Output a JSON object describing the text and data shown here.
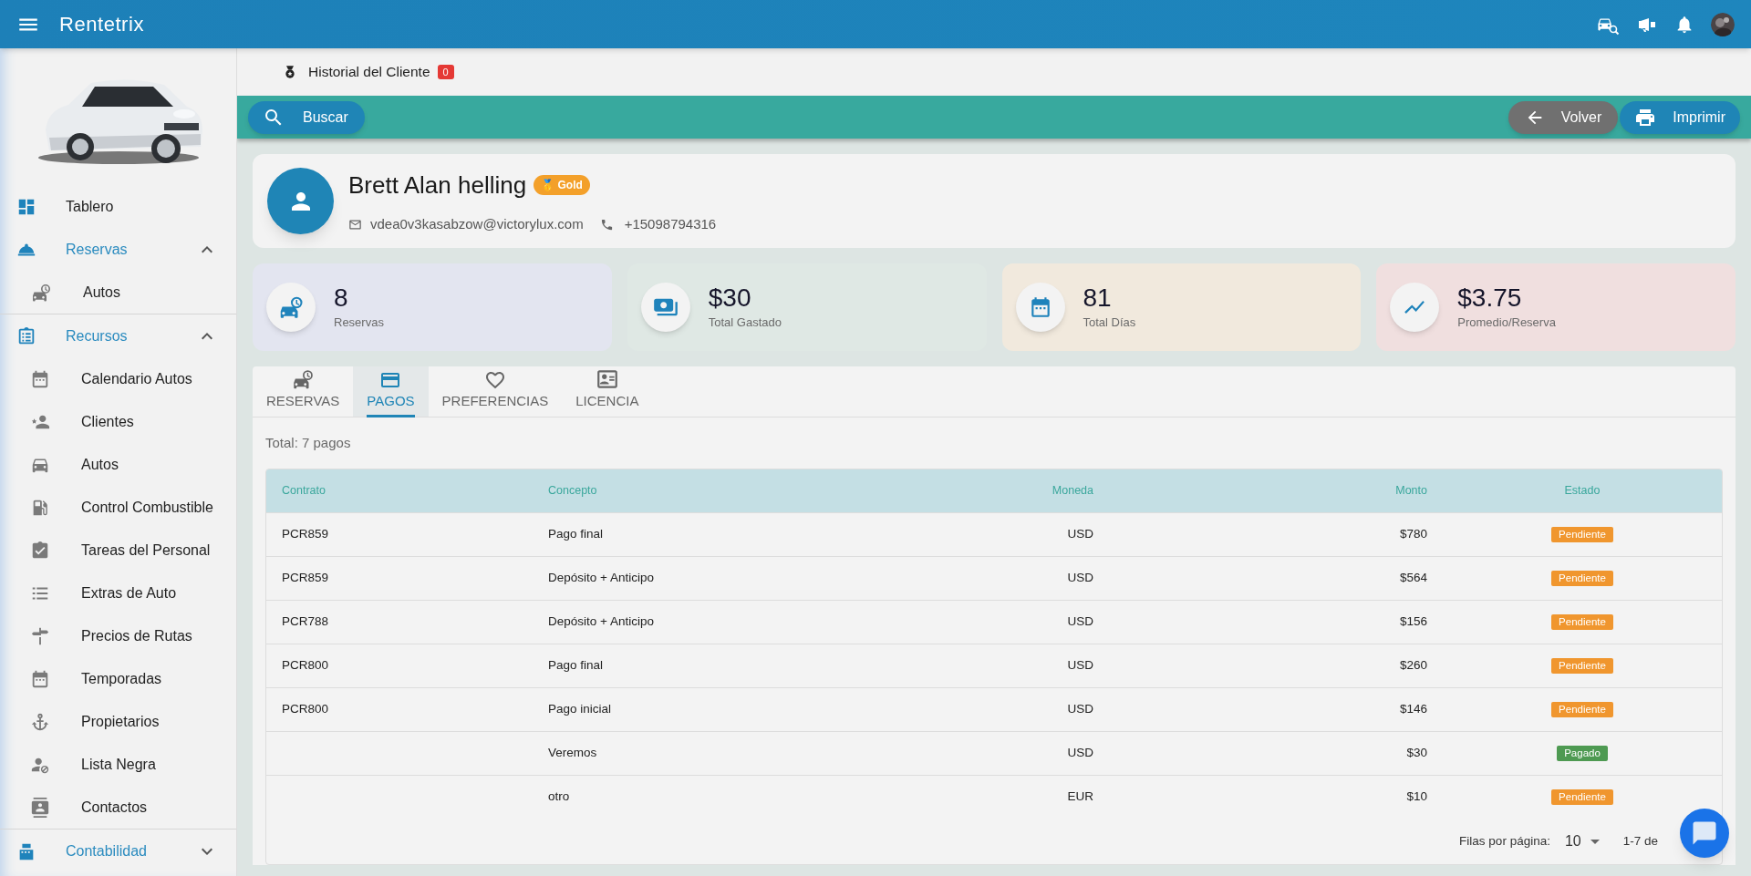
{
  "app": {
    "title": "Rentetrix"
  },
  "sidebar": {
    "items": [
      {
        "kind": "item",
        "label": "Tablero"
      },
      {
        "kind": "group",
        "label": "Reservas",
        "expanded": true,
        "children": [
          {
            "label": "Autos"
          }
        ]
      },
      {
        "kind": "group",
        "label": "Recursos",
        "expanded": true,
        "children": [
          {
            "label": "Calendario Autos"
          },
          {
            "label": "Clientes"
          },
          {
            "label": "Autos"
          },
          {
            "label": "Control Combustible"
          },
          {
            "label": "Tareas del Personal"
          },
          {
            "label": "Extras de Auto"
          },
          {
            "label": "Precios de Rutas"
          },
          {
            "label": "Temporadas"
          },
          {
            "label": "Propietarios"
          },
          {
            "label": "Lista Negra"
          },
          {
            "label": "Contactos"
          }
        ]
      },
      {
        "kind": "group",
        "label": "Contabilidad",
        "expanded": false
      }
    ]
  },
  "page_header": {
    "title": "Historial del Cliente",
    "badge": "0"
  },
  "toolbar": {
    "search_button": "Buscar",
    "back_button": "Volver",
    "print_button": "Imprimir"
  },
  "customer": {
    "name": "Brett Alan helling",
    "tier": "🥇 Gold",
    "email": "vdea0v3kasabzow@victorylux.com",
    "phone": "+15098794316"
  },
  "stats": [
    {
      "value": "8",
      "label": "Reservas",
      "color": "#e3e5f0"
    },
    {
      "value": "$30",
      "label": "Total Gastado",
      "color": "#dfe8e4"
    },
    {
      "value": "81",
      "label": "Total Días",
      "color": "#f1e9dd"
    },
    {
      "value": "$3.75",
      "label": "Promedio/Reserva",
      "color": "#f0dfdf"
    }
  ],
  "tabs": [
    {
      "label": "RESERVAS",
      "selected": false
    },
    {
      "label": "PAGOS",
      "selected": true
    },
    {
      "label": "PREFERENCIAS",
      "selected": false
    },
    {
      "label": "LICENCIA",
      "selected": false
    }
  ],
  "summary": "Total: 7 pagos",
  "table": {
    "columns": [
      "Contrato",
      "Concepto",
      "Moneda",
      "Monto",
      "Estado"
    ],
    "rows": [
      {
        "contract": "PCR859",
        "concept": "Pago final",
        "currency": "USD",
        "amount": "$780",
        "status": {
          "text": "Pendiente",
          "kind": "pending"
        }
      },
      {
        "contract": "PCR859",
        "concept": "Depósito + Anticipo",
        "currency": "USD",
        "amount": "$564",
        "status": {
          "text": "Pendiente",
          "kind": "pending"
        }
      },
      {
        "contract": "PCR788",
        "concept": "Depósito + Anticipo",
        "currency": "USD",
        "amount": "$156",
        "status": {
          "text": "Pendiente",
          "kind": "pending"
        }
      },
      {
        "contract": "PCR800",
        "concept": "Pago final",
        "currency": "USD",
        "amount": "$260",
        "status": {
          "text": "Pendiente",
          "kind": "pending"
        }
      },
      {
        "contract": "PCR800",
        "concept": "Pago inicial",
        "currency": "USD",
        "amount": "$146",
        "status": {
          "text": "Pendiente",
          "kind": "pending"
        }
      },
      {
        "concept": "Veremos",
        "currency": "USD",
        "amount": "$30",
        "status": {
          "text": "Pagado",
          "kind": "paid"
        }
      },
      {
        "concept": "otro",
        "currency": "EUR",
        "amount": "$10",
        "status": {
          "text": "Pendiente",
          "kind": "pending"
        }
      }
    ]
  },
  "pagination": {
    "rows_label": "Filas por página:",
    "rows_per_page": "10",
    "range": "1-7 de"
  }
}
